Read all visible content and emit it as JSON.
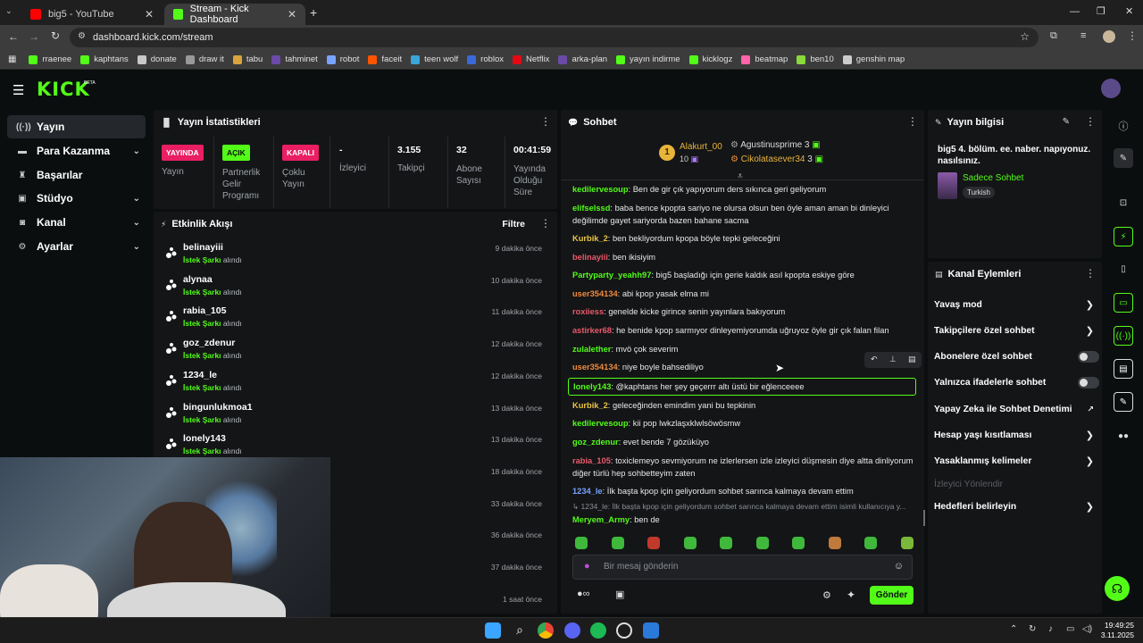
{
  "browser": {
    "tabs": [
      {
        "title": "big5 - YouTube",
        "active": false
      },
      {
        "title": "Stream - Kick Dashboard",
        "active": true
      }
    ],
    "url": "dashboard.kick.com/stream",
    "bookmarks": [
      "rraenee",
      "kaphtans",
      "donate",
      "draw it",
      "tabu",
      "tahminet",
      "robot",
      "faceit",
      "teen wolf",
      "roblox",
      "Netflix",
      "arka-plan",
      "yayın indirme",
      "kicklogz",
      "beatmap",
      "ben10",
      "genshin map"
    ]
  },
  "kick": {
    "logo": "KICK",
    "beta": "BETA"
  },
  "sidebar": {
    "items": [
      {
        "label": "Yayın",
        "icon": "broadcast-icon",
        "active": true
      },
      {
        "label": "Para Kazanma",
        "icon": "money-icon",
        "chevron": true
      },
      {
        "label": "Başarılar",
        "icon": "trophy-icon"
      },
      {
        "label": "Stüdyo",
        "icon": "studio-icon",
        "chevron": true
      },
      {
        "label": "Kanal",
        "icon": "channel-icon",
        "chevron": true
      },
      {
        "label": "Ayarlar",
        "icon": "gear-icon",
        "chevron": true
      }
    ]
  },
  "stats": {
    "title": "Yayın İstatistikleri",
    "cols": [
      {
        "badge": "YAYINDA",
        "badge_color": "#e91e63",
        "label": "Yayın"
      },
      {
        "badge": "AÇIK",
        "badge_color": "#53fc18",
        "label": "Partnerlik Gelir Programı"
      },
      {
        "badge": "KAPALI",
        "badge_color": "#e91e63",
        "label": "Çoklu Yayın"
      },
      {
        "value": "-",
        "label": "İzleyici"
      },
      {
        "value": "3.155",
        "label": "Takipçi"
      },
      {
        "value": "32",
        "label": "Abone Sayısı"
      },
      {
        "value": "00:41:59",
        "label": "Yayında Olduğu Süre"
      }
    ]
  },
  "activity": {
    "title": "Etkinlik Akışı",
    "filter": "Filtre",
    "event_label": "İstek Şarkı",
    "event_suffix": "alındı",
    "items": [
      {
        "name": "belinayiii",
        "time": "9 dakika önce"
      },
      {
        "name": "alynaa",
        "time": "10 dakika önce"
      },
      {
        "name": "rabia_105",
        "time": "11 dakika önce"
      },
      {
        "name": "goz_zdenur",
        "time": "12 dakika önce"
      },
      {
        "name": "1234_le",
        "time": "12 dakika önce"
      },
      {
        "name": "bingunlukmoa1",
        "time": "13 dakika önce"
      },
      {
        "name": "lonely143",
        "time": "13 dakika önce"
      },
      {
        "name": "",
        "time": "18 dakika önce"
      },
      {
        "name": "",
        "time": "33 dakika önce"
      },
      {
        "name": "",
        "time": "36 dakika önce"
      },
      {
        "name": "",
        "time": "37 dakika önce"
      },
      {
        "name": "",
        "time": "1 saat önce"
      }
    ]
  },
  "chat": {
    "title": "Sohbet",
    "leader": {
      "name": "Alakurt_00",
      "rank": "1",
      "count": "10"
    },
    "others": [
      {
        "name": "Agustinusprime",
        "count": "3"
      },
      {
        "name": "Cikolatasever34",
        "count": "3"
      }
    ],
    "messages": [
      {
        "user": "kedilervesoup",
        "color": "#53fc18",
        "text": "Ben de gir çık yapıyorum ders sıkınca geri geliyorum"
      },
      {
        "user": "elifselssd",
        "color": "#53fc18",
        "text": "baba bence kpopta sariyo ne olursa olsun ben öyle aman aman bi dinleyici değilimde gayet sariyorda bazen bahane sacma"
      },
      {
        "user": "Kurbik_2",
        "color": "#e8c546",
        "text": "ben bekliyordum kpopa böyle tepki geleceğini"
      },
      {
        "user": "belinayiii",
        "color": "#e85a6a",
        "text": "ben ikisiyim"
      },
      {
        "user": "Partyparty_yeahh97",
        "color": "#53fc18",
        "text": "big5 başladığı için gerie kaldık asıl kpopta eskiye göre"
      },
      {
        "user": "user354134",
        "color": "#f08a3a",
        "text": "abi kpop yasak elma mi"
      },
      {
        "user": "roxiiess",
        "color": "#e85a6a",
        "text": "genelde kicke girince senin yayınlara bakıyorum"
      },
      {
        "user": "astirker68",
        "color": "#e85a6a",
        "text": "he benide kpop sarmıyor dinleyemiyorumda uğruyoz öyle gir çık falan filan"
      },
      {
        "user": "zulalether",
        "color": "#53fc18",
        "text": "mvö çok severim"
      },
      {
        "user": "user354134",
        "color": "#f08a3a",
        "text": "niye boyle bahsediliyo"
      },
      {
        "user": "lonely143",
        "color": "#53fc18",
        "text": "@kaphtans her şey geçerrr altı üstü bir eğlenceeee"
      },
      {
        "user": "Kurbik_2",
        "color": "#e8c546",
        "text": "geleceğinden emindim yani bu tepkinin"
      },
      {
        "user": "kedilervesoup",
        "color": "#53fc18",
        "text": "kii pop lwkzlaşxklwlsöwösmw"
      },
      {
        "user": "goz_zdenur",
        "color": "#53fc18",
        "text": "evet bende 7 gözüküyo"
      },
      {
        "user": "rabia_105",
        "color": "#e85a6a",
        "text": "toxiclemeyo sevmiyorum ne izlerlersen izle izleyici düşmesin diye altta dinliyorum diğer türlü hep sohbetteyim zaten"
      },
      {
        "user": "1234_le",
        "color": "#7aa3ff",
        "text": "İlk başta kpop için geliyordum sohbet sarınca kalmaya devam ettim"
      },
      {
        "user": "Meryem_Army",
        "color": "#53fc18",
        "text": "ben de"
      }
    ],
    "reply_preview": "↳ 1234_le: İlk başta kpop için geliyordum sohbet sarınca kalmaya devam ettim isimli kullanıcıya y...",
    "input_placeholder": "Bir mesaj gönderin",
    "send_label": "Gönder"
  },
  "info": {
    "title": "Yayın bilgisi",
    "stream_title": "big5 4. bölüm. ee. naber. napıyonuz. nasılsınız.",
    "category": "Sadece Sohbet",
    "language": "Turkish"
  },
  "actions": {
    "title": "Kanal Eylemleri",
    "items": [
      {
        "label": "Yavaş mod",
        "type": "chevron"
      },
      {
        "label": "Takipçilere özel sohbet",
        "type": "chevron"
      },
      {
        "label": "Abonelere özel sohbet",
        "type": "toggle"
      },
      {
        "label": "Yalnızca ifadelerle sohbet",
        "type": "toggle"
      },
      {
        "label": "Yapay Zeka ile Sohbet Denetimi",
        "type": "external"
      },
      {
        "label": "Hesap yaşı kısıtlaması",
        "type": "chevron"
      },
      {
        "label": "Yasaklanmış kelimeler",
        "type": "chevron"
      },
      {
        "label": "İzleyici Yönlendir",
        "type": "disabled"
      },
      {
        "label": "Hedefleri belirleyin",
        "type": "chevron"
      }
    ]
  },
  "taskbar": {
    "time": "19:49:25",
    "date": "3.11.2025"
  }
}
